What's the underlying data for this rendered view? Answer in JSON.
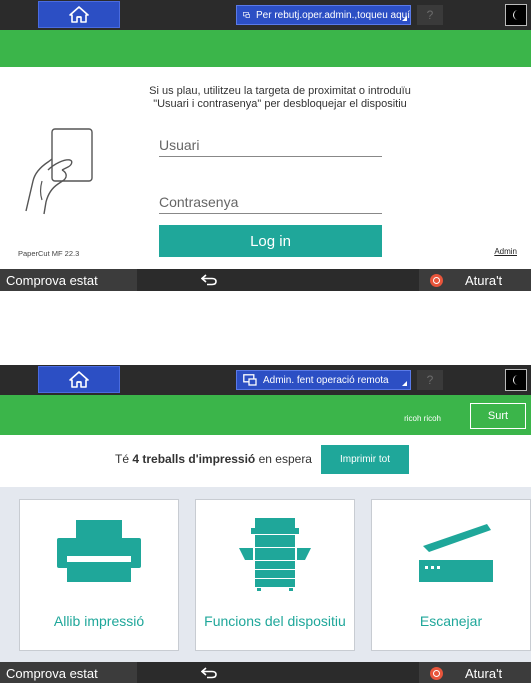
{
  "colors": {
    "accent": "#1fa79a",
    "header_green": "#3bb54a",
    "bar_dark": "#2b2b2b",
    "home_blue": "#2c4fc4",
    "stop_red": "#e8553b"
  },
  "screen1": {
    "topbar": {
      "home_icon": "home-icon",
      "status_text": "Per rebutj.oper.admin.,toqueu aquí",
      "help_label": "?",
      "night_icon": "moon-icon"
    },
    "login": {
      "message_line1": "Si us plau, utilitzeu la targeta de proximitat o introduïu",
      "message_line2": "\"Usuari i contrasenya\" per desbloquejar el dispositiu",
      "username_placeholder": "Usuari",
      "password_placeholder": "Contrasenya",
      "login_label": "Log in",
      "version": "PaperCut MF 22.3",
      "admin_link": "Admin"
    },
    "bottombar": {
      "status_label": "Comprova estat",
      "stop_label": "Atura't"
    }
  },
  "screen2": {
    "topbar": {
      "home_icon": "home-icon",
      "status_text": "Admin. fent operació remota",
      "help_label": "?",
      "night_icon": "moon-icon"
    },
    "header": {
      "user_name": "ricoh ricoh",
      "exit_label": "Surt"
    },
    "jobs": {
      "prefix": "Té",
      "count_text": "4 treballs d'impressió",
      "suffix": "en espera",
      "print_all_label": "Imprimir tot"
    },
    "tiles": [
      {
        "icon": "printer-icon",
        "label": "Allib impressió"
      },
      {
        "icon": "copier-icon",
        "label": "Funcions del dispositiu"
      },
      {
        "icon": "scanner-icon",
        "label": "Escanejar"
      }
    ],
    "bottombar": {
      "status_label": "Comprova estat",
      "stop_label": "Atura't"
    }
  }
}
